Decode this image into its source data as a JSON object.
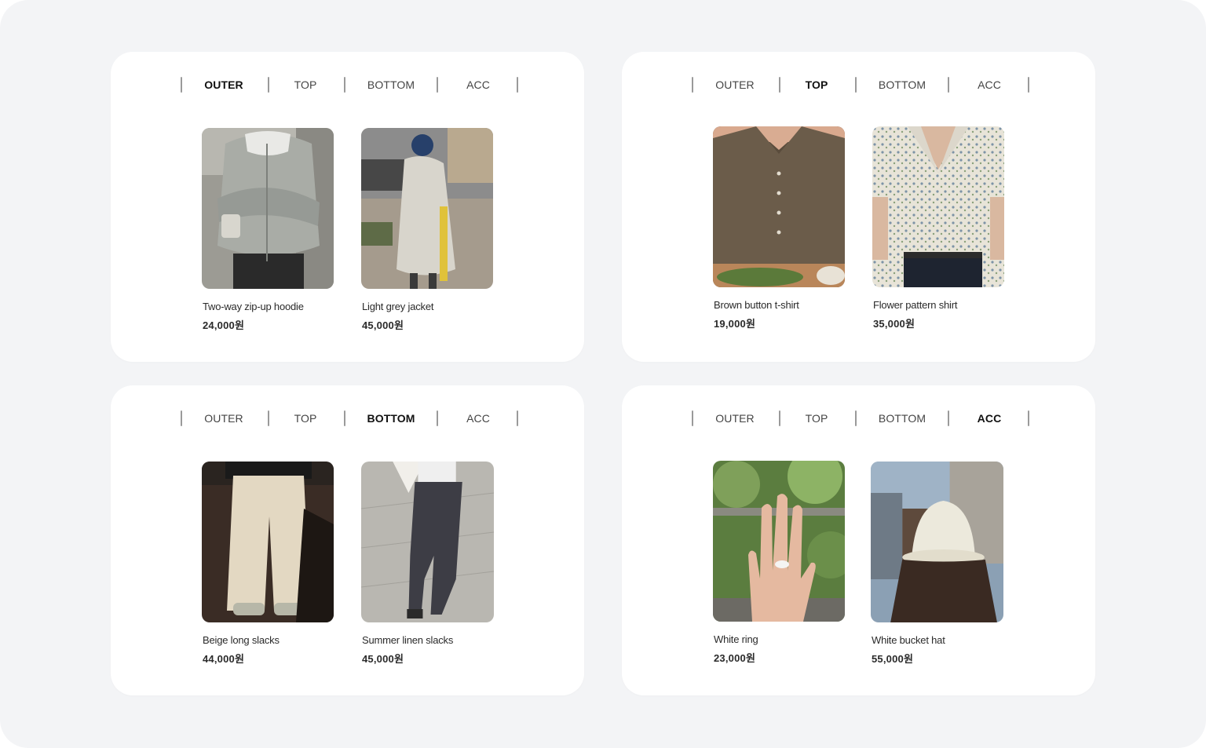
{
  "panels": [
    {
      "tabs": [
        "OUTER",
        "TOP",
        "BOTTOM",
        "ACC"
      ],
      "active_tab": "OUTER",
      "products": [
        {
          "name": "Two-way zip-up hoodie",
          "price": "24,000원",
          "image": "grey-hoodie-photo"
        },
        {
          "name": "Light grey jacket",
          "price": "45,000원",
          "image": "grey-jacket-photo"
        }
      ]
    },
    {
      "tabs": [
        "OUTER",
        "TOP",
        "BOTTOM",
        "ACC"
      ],
      "active_tab": "TOP",
      "products": [
        {
          "name": "Brown button t-shirt",
          "price": "19,000원",
          "image": "brown-shirt-photo"
        },
        {
          "name": "Flower pattern shirt",
          "price": "35,000원",
          "image": "flower-shirt-photo"
        }
      ]
    },
    {
      "tabs": [
        "OUTER",
        "TOP",
        "BOTTOM",
        "ACC"
      ],
      "active_tab": "BOTTOM",
      "products": [
        {
          "name": "Beige long slacks",
          "price": "44,000원",
          "image": "beige-slacks-photo"
        },
        {
          "name": "Summer linen slacks",
          "price": "45,000원",
          "image": "linen-slacks-photo"
        }
      ]
    },
    {
      "tabs": [
        "OUTER",
        "TOP",
        "BOTTOM",
        "ACC"
      ],
      "active_tab": "ACC",
      "products": [
        {
          "name": "White ring",
          "price": "23,000원",
          "image": "ring-hand-photo"
        },
        {
          "name": "White bucket hat",
          "price": "55,000원",
          "image": "bucket-hat-photo"
        }
      ]
    }
  ],
  "colors": {
    "page_background": "#f3f4f6",
    "card_background": "#ffffff",
    "active_tab_text": "#111111",
    "tab_text": "#444444",
    "separator": "#9a9a9a"
  }
}
